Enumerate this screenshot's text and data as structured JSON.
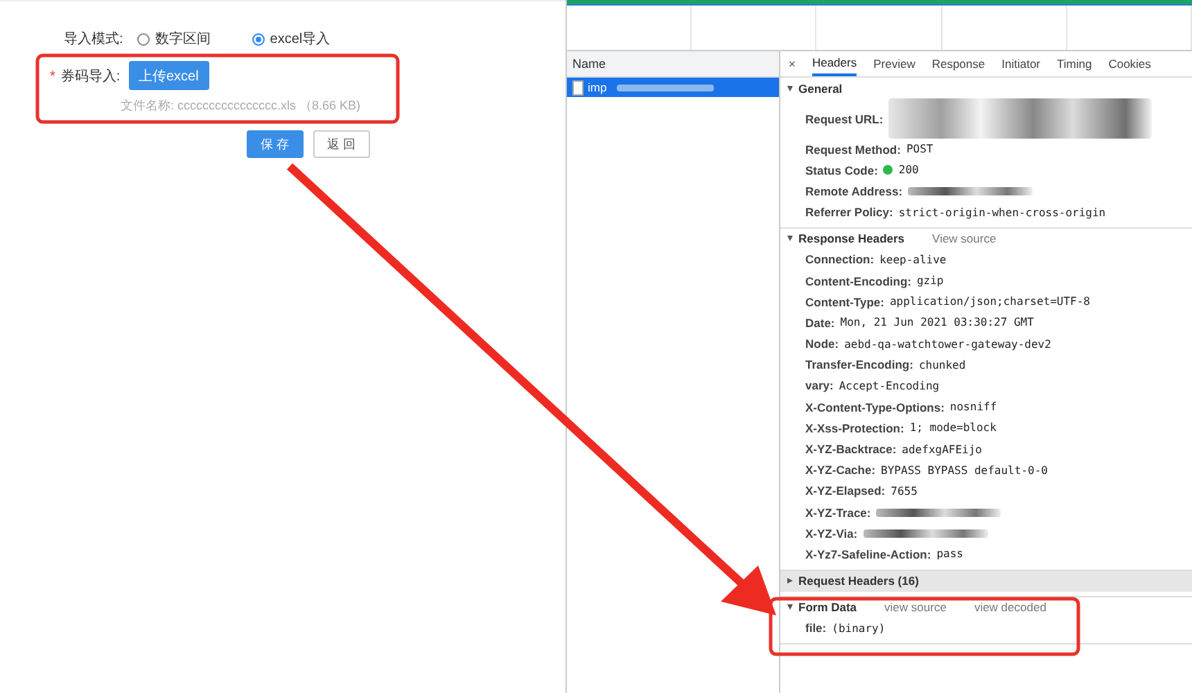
{
  "form": {
    "mode_label": "导入模式:",
    "mode_options": [
      {
        "label": "数字区间",
        "selected": false
      },
      {
        "label": "excel导入",
        "selected": true
      }
    ],
    "import_label": "券码导入:",
    "required_mark": "*",
    "upload_button": "上传excel",
    "file_info": "文件名称: cccccccccccccccc.xls （8.66 KB)",
    "buttons": [
      {
        "label": "保 存",
        "kind": "primary"
      },
      {
        "label": "返 回",
        "kind": "default"
      }
    ]
  },
  "devtools": {
    "name_header": "Name",
    "requests": [
      {
        "name": "imp",
        "selected": true
      }
    ],
    "close": "×",
    "tabs": [
      {
        "label": "Headers",
        "selected": true
      },
      {
        "label": "Preview",
        "selected": false
      },
      {
        "label": "Response",
        "selected": false
      },
      {
        "label": "Initiator",
        "selected": false
      },
      {
        "label": "Timing",
        "selected": false
      },
      {
        "label": "Cookies",
        "selected": false
      }
    ],
    "sections": [
      {
        "title": "General",
        "expanded": true,
        "rows": [
          {
            "key": "Request URL:",
            "redacted": true,
            "kind": "url"
          },
          {
            "key": "Request Method:",
            "value": "POST"
          },
          {
            "key": "Status Code:",
            "value": "200",
            "kind": "status"
          },
          {
            "key": "Remote Address:",
            "redacted": true
          },
          {
            "key": "Referrer Policy:",
            "value": "strict-origin-when-cross-origin"
          }
        ]
      },
      {
        "title": "Response Headers",
        "expanded": true,
        "links": [
          "View source"
        ],
        "rows": [
          {
            "key": "Connection:",
            "value": "keep-alive"
          },
          {
            "key": "Content-Encoding:",
            "value": "gzip"
          },
          {
            "key": "Content-Type:",
            "value": "application/json;charset=UTF-8"
          },
          {
            "key": "Date:",
            "value": "Mon, 21 Jun 2021 03:30:27 GMT"
          },
          {
            "key": "Node:",
            "value": "aebd-qa-watchtower-gateway-dev2"
          },
          {
            "key": "Transfer-Encoding:",
            "value": "chunked"
          },
          {
            "key": "vary:",
            "value": "Accept-Encoding"
          },
          {
            "key": "X-Content-Type-Options:",
            "value": "nosniff"
          },
          {
            "key": "X-Xss-Protection:",
            "value": "1; mode=block"
          },
          {
            "key": "X-YZ-Backtrace:",
            "value": "adefxgAFEijo"
          },
          {
            "key": "X-YZ-Cache:",
            "value": "BYPASS BYPASS default-0-0"
          },
          {
            "key": "X-YZ-Elapsed:",
            "value": "7655"
          },
          {
            "key": "X-YZ-Trace:",
            "redacted": true
          },
          {
            "key": "X-YZ-Via:",
            "redacted": true
          },
          {
            "key": "X-Yz7-Safeline-Action:",
            "value": "pass"
          }
        ]
      },
      {
        "title": "Request Headers (16)",
        "expanded": false
      },
      {
        "title": "Form Data",
        "expanded": true,
        "links": [
          "view source",
          "view decoded"
        ],
        "rows": [
          {
            "key": "file:",
            "value": "(binary)"
          }
        ]
      }
    ]
  }
}
